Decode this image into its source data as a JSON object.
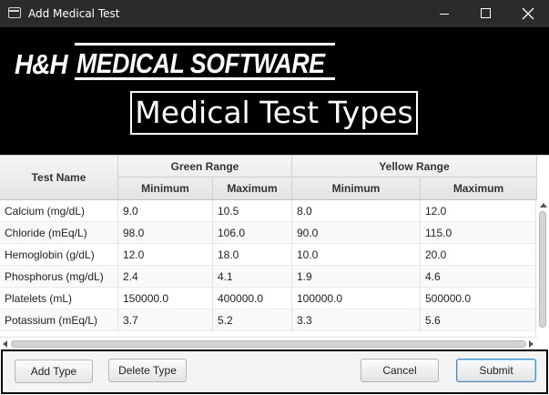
{
  "window": {
    "title": "Add Medical Test",
    "controls": {
      "minimize_icon": "minimize-icon",
      "maximize_icon": "maximize-icon",
      "close_icon": "close-icon"
    }
  },
  "banner": {
    "logo_prefix": "H&H",
    "logo_main": "MEDICAL SOFTWARE",
    "page_title": "Medical Test Types",
    "background": "#000000",
    "text_color": "#ffffff"
  },
  "table": {
    "headers": {
      "test_name": "Test Name",
      "green_range": "Green Range",
      "yellow_range": "Yellow Range",
      "green_min": "Minimum",
      "green_max": "Maximum",
      "yellow_min": "Minimum",
      "yellow_max": "Maximum"
    },
    "rows": [
      {
        "name": "Calcium (mg/dL)",
        "green_min": "9.0",
        "green_max": "10.5",
        "yellow_min": "8.0",
        "yellow_max": "12.0"
      },
      {
        "name": "Chloride (mEq/L)",
        "green_min": "98.0",
        "green_max": "106.0",
        "yellow_min": "90.0",
        "yellow_max": "115.0"
      },
      {
        "name": "Hemoglobin (g/dL)",
        "green_min": "12.0",
        "green_max": "18.0",
        "yellow_min": "10.0",
        "yellow_max": "20.0"
      },
      {
        "name": "Phosphorus (mg/dL)",
        "green_min": "2.4",
        "green_max": "4.1",
        "yellow_min": "1.9",
        "yellow_max": "4.6"
      },
      {
        "name": "Platelets (mL)",
        "green_min": "150000.0",
        "green_max": "400000.0",
        "yellow_min": "100000.0",
        "yellow_max": "500000.0"
      },
      {
        "name": "Potassium (mEq/L)",
        "green_min": "3.7",
        "green_max": "5.2",
        "yellow_min": "3.3",
        "yellow_max": "5.6"
      }
    ]
  },
  "footer": {
    "add_type": "Add Type",
    "delete_type": "Delete Type",
    "cancel": "Cancel",
    "submit": "Submit"
  }
}
